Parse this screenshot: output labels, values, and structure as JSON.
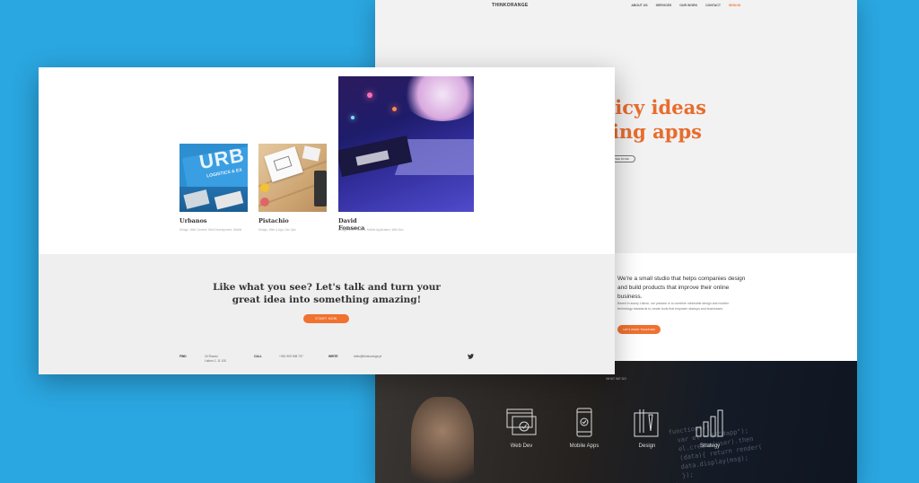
{
  "back": {
    "logo": "THINKORANGE",
    "nav": [
      "ABOUT US",
      "SERVICES",
      "OUR WORK",
      "CONTACT",
      "SIGN IN"
    ],
    "hero": "uicy ideas\nzing apps",
    "hero_button": "SEE MORE",
    "about_lead": "We're a small studio that helps companies design and build products that improve their online business.",
    "about_small": "Based in sunny Lisbon, our passion is to combine minimalist design and modern technology standards to create tools that empower startups and businesses.",
    "about_cta": "LET'S WORK TOGETHER",
    "what_we_do": "What we do",
    "services": [
      "Web Dev",
      "Mobile Apps",
      "Design",
      "Strategy"
    ]
  },
  "front": {
    "cards": [
      {
        "title": "Urbanos",
        "sub": "Design, Web Content, Web Development, Mobile",
        "thumb_text": "URB",
        "thumb_sub": "LOGISTICS & EX"
      },
      {
        "title": "Pistachio",
        "sub": "Design, Web & App, Dev Ops"
      },
      {
        "title": "David Fonseca",
        "sub": "Design, Web Content, Mobile Application, Web Dev"
      }
    ],
    "talk_heading_1": "Like what you see? Let's talk and turn your",
    "talk_heading_2": "great idea into something amazing!",
    "talk_button": "START NOW",
    "footer": {
      "find_label": "Find",
      "find_value_1": "34 Rossio",
      "find_value_2": "Lisbon 1, 11 100",
      "call_label": "Call",
      "call_value": "+351 909 908 707",
      "write_label": "Write",
      "write_value": "hello@thinkorange.pt"
    }
  },
  "colors": {
    "accent": "#f07130",
    "background": "#2aa6e0"
  }
}
